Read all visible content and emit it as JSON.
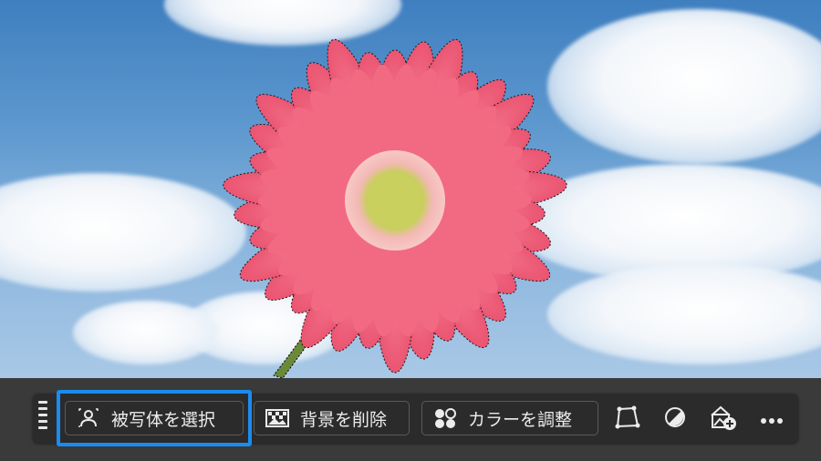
{
  "toolbar": {
    "select_subject_label": "被写体を選択",
    "remove_background_label": "背景を削除",
    "adjust_color_label": "カラーを調整"
  },
  "icons": {
    "select_subject": "person-select-icon",
    "remove_background": "image-remove-icon",
    "adjust_color": "color-adjust-icon",
    "polygon": "polygon-lasso-icon",
    "contrast": "contrast-icon",
    "generative": "image-add-icon",
    "more": "more-icon"
  },
  "colors": {
    "highlight": "#1a8cf0",
    "toolbar_bg": "#2b2b2b",
    "petal": "#f0607a"
  }
}
